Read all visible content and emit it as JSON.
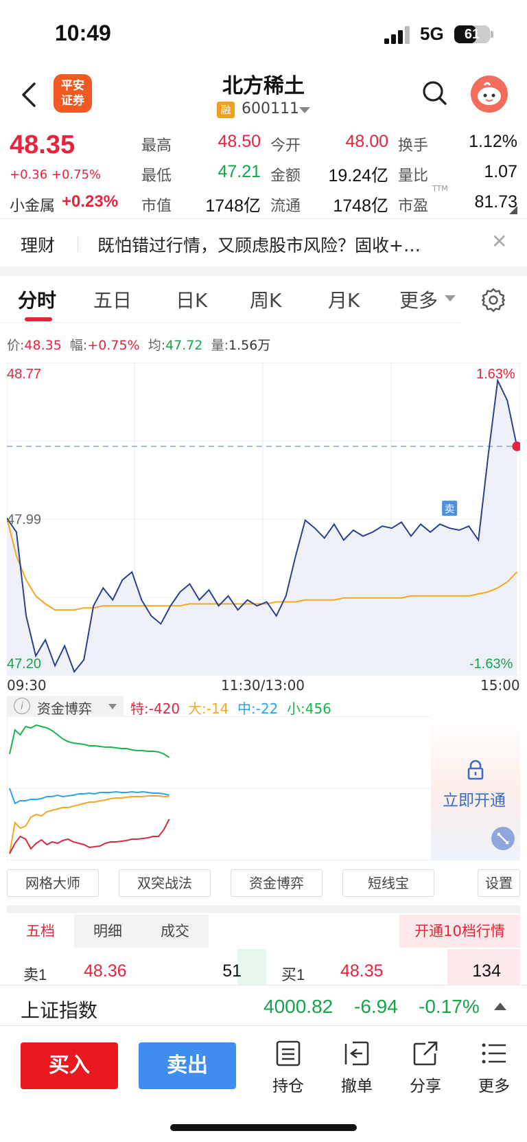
{
  "status_bar": {
    "time": "10:49",
    "network": "5G",
    "battery": "61",
    "battery_level": 0.61
  },
  "header": {
    "stock_name": "北方稀土",
    "stock_code": "600111",
    "margin_tag": "融",
    "broker_logo": "平安\n证券"
  },
  "quote": {
    "price": "48.35",
    "change": "+0.36 +0.75%",
    "sector_label": "小金属",
    "sector_change": "+0.23%",
    "rows": [
      {
        "label": "最高",
        "value": "48.50",
        "label2": "今开",
        "value2": "48.00",
        "label3": "换手",
        "value3": "1.12%"
      },
      {
        "label": "最低",
        "value": "47.21",
        "label2": "金额",
        "value2": "19.24亿",
        "label3": "量比",
        "value3": "1.07"
      },
      {
        "label": "市值",
        "value": "1748亿",
        "label2": "流通",
        "value2": "1748亿",
        "label3": "市盈",
        "value3": "81.73"
      }
    ],
    "ttm": "TTM"
  },
  "banner": {
    "tag": "理财",
    "text": "既怕错过行情，又顾虑股市风险？固收+…"
  },
  "tabs": [
    "分时",
    "五日",
    "日K",
    "周K",
    "月K",
    "更多"
  ],
  "summary": {
    "price_label": "价:",
    "price": "48.35",
    "amp_label": "幅:",
    "amp": "+0.75%",
    "avg_label": "均:",
    "avg": "47.72",
    "vol_label": "量:",
    "vol": "1.56万"
  },
  "chart_data": {
    "type": "line",
    "y_top": "48.77",
    "y_mid": "47.99",
    "y_bottom": "47.20",
    "pct_top": "1.63%",
    "pct_bottom": "-1.63%",
    "time_start": "09:30",
    "time_mid": "11:30/13:00",
    "time_end": "15:00",
    "sell_marker": "卖",
    "ylim": [
      47.2,
      48.77
    ],
    "prev_close": 47.99,
    "series": [
      {
        "color": "#2b3f8f",
        "values": [
          47.99,
          47.92,
          47.5,
          47.3,
          47.38,
          47.25,
          47.35,
          47.22,
          47.28,
          47.55,
          47.64,
          47.58,
          47.68,
          47.72,
          47.58,
          47.5,
          47.46,
          47.55,
          47.62,
          47.66,
          47.58,
          47.63,
          47.55,
          47.6,
          47.53,
          47.58,
          47.55,
          47.57,
          47.5,
          47.6,
          47.8,
          47.98,
          47.94,
          47.89,
          47.96,
          47.88,
          47.93,
          47.9,
          47.92,
          47.95,
          47.94,
          47.97,
          47.9,
          47.96,
          47.92,
          47.96,
          47.94,
          47.93,
          47.95,
          47.88,
          48.3,
          48.68,
          48.58,
          48.35
        ]
      },
      {
        "color": "#f5a623",
        "values": [
          47.99,
          47.8,
          47.68,
          47.6,
          47.56,
          47.53,
          47.53,
          47.53,
          47.54,
          47.54,
          47.55,
          47.55,
          47.55,
          47.55,
          47.55,
          47.55,
          47.55,
          47.55,
          47.55,
          47.56,
          47.56,
          47.56,
          47.56,
          47.56,
          47.56,
          47.56,
          47.56,
          47.56,
          47.57,
          47.57,
          47.57,
          47.58,
          47.58,
          47.58,
          47.58,
          47.59,
          47.59,
          47.59,
          47.59,
          47.59,
          47.59,
          47.59,
          47.6,
          47.6,
          47.6,
          47.6,
          47.6,
          47.6,
          47.6,
          47.61,
          47.62,
          47.64,
          47.67,
          47.72
        ]
      }
    ]
  },
  "fund_flow": {
    "title": "资金博弈",
    "super": "特:-420",
    "large": "大:-14",
    "medium": "中:-22",
    "small": "小:456",
    "unlock": "立即开通",
    "series": [
      {
        "color": "#19b54c",
        "values": [
          0.5,
          0.85,
          0.78,
          0.9,
          0.88,
          0.92,
          0.9,
          0.88,
          0.84,
          0.78,
          0.72,
          0.68,
          0.66,
          0.65,
          0.64,
          0.62,
          0.62,
          0.61,
          0.6,
          0.6,
          0.59,
          0.58,
          0.58,
          0.56,
          0.55,
          0.55,
          0.54,
          0.54,
          0.53,
          0.5,
          0.45
        ]
      },
      {
        "color": "#29a3f0",
        "values": [
          0.0,
          -0.22,
          -0.18,
          -0.18,
          -0.16,
          -0.16,
          -0.15,
          -0.12,
          -0.12,
          -0.1,
          -0.12,
          -0.11,
          -0.1,
          -0.08,
          -0.08,
          -0.07,
          -0.08,
          -0.06,
          -0.06,
          -0.06,
          -0.05,
          -0.06,
          -0.06,
          -0.05,
          -0.06,
          -0.05,
          -0.06,
          -0.07,
          -0.07,
          -0.08,
          -0.1
        ]
      },
      {
        "color": "#f5a623",
        "values": [
          -0.95,
          -0.5,
          -0.58,
          -0.55,
          -0.42,
          -0.38,
          -0.4,
          -0.34,
          -0.32,
          -0.3,
          -0.28,
          -0.28,
          -0.26,
          -0.24,
          -0.22,
          -0.2,
          -0.2,
          -0.18,
          -0.17,
          -0.15,
          -0.14,
          -0.14,
          -0.13,
          -0.12,
          -0.12,
          -0.12,
          -0.11,
          -0.11,
          -0.11,
          -0.12,
          -0.12
        ]
      },
      {
        "color": "#d42a43",
        "values": [
          -0.95,
          -0.8,
          -0.7,
          -0.74,
          -0.88,
          -0.8,
          -0.75,
          -0.82,
          -0.78,
          -0.8,
          -0.76,
          -0.74,
          -0.78,
          -0.8,
          -0.82,
          -0.86,
          -0.85,
          -0.84,
          -0.8,
          -0.78,
          -0.78,
          -0.77,
          -0.76,
          -0.74,
          -0.74,
          -0.73,
          -0.72,
          -0.7,
          -0.7,
          -0.6,
          -0.45
        ]
      }
    ]
  },
  "tools": [
    "网格大师",
    "双突战法",
    "资金博弈",
    "短线宝",
    "设置"
  ],
  "order_book": {
    "tabs": [
      "五档",
      "明细",
      "成交"
    ],
    "open_10": "开通10档行情",
    "sell1_label": "卖1",
    "sell1_price": "48.36",
    "sell1_vol": "51",
    "buy1_label": "买1",
    "buy1_price": "48.35",
    "buy1_vol": "134"
  },
  "index": {
    "name": "上证指数",
    "value": "4000.82",
    "change": "-6.94",
    "pct": "-0.17%"
  },
  "bottom_bar": {
    "buy": "买入",
    "sell": "卖出",
    "items": [
      "持仓",
      "撤单",
      "分享",
      "更多"
    ]
  }
}
